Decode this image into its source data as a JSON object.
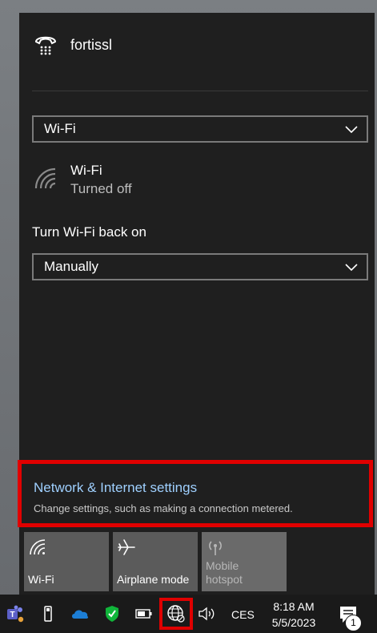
{
  "vpn": {
    "name": "fortissl",
    "icon": "vpn-phone-icon"
  },
  "network_selector": {
    "value": "Wi-Fi"
  },
  "wifi": {
    "name": "Wi-Fi",
    "state": "Turned off",
    "icon": "wifi-off-icon"
  },
  "turn_back_on": {
    "label": "Turn Wi-Fi back on",
    "value": "Manually"
  },
  "settings_link": {
    "title": "Network & Internet settings",
    "description": "Change settings, such as making a connection metered."
  },
  "quick_actions": [
    {
      "label": "Wi-Fi",
      "icon": "wifi-icon",
      "enabled": true
    },
    {
      "label": "Airplane mode",
      "icon": "airplane-icon",
      "enabled": true
    },
    {
      "label_line1": "Mobile",
      "label_line2": "hotspot",
      "icon": "hotspot-icon",
      "enabled": false
    }
  ],
  "taskbar": {
    "language": "CES",
    "time": "8:18 AM",
    "date": "5/5/2023",
    "notification_count": "1",
    "colors": {
      "highlight": "#e00000",
      "defender": "#10b53a",
      "onedrive": "#1c7ed6",
      "teams": "#5b5fc7"
    }
  }
}
